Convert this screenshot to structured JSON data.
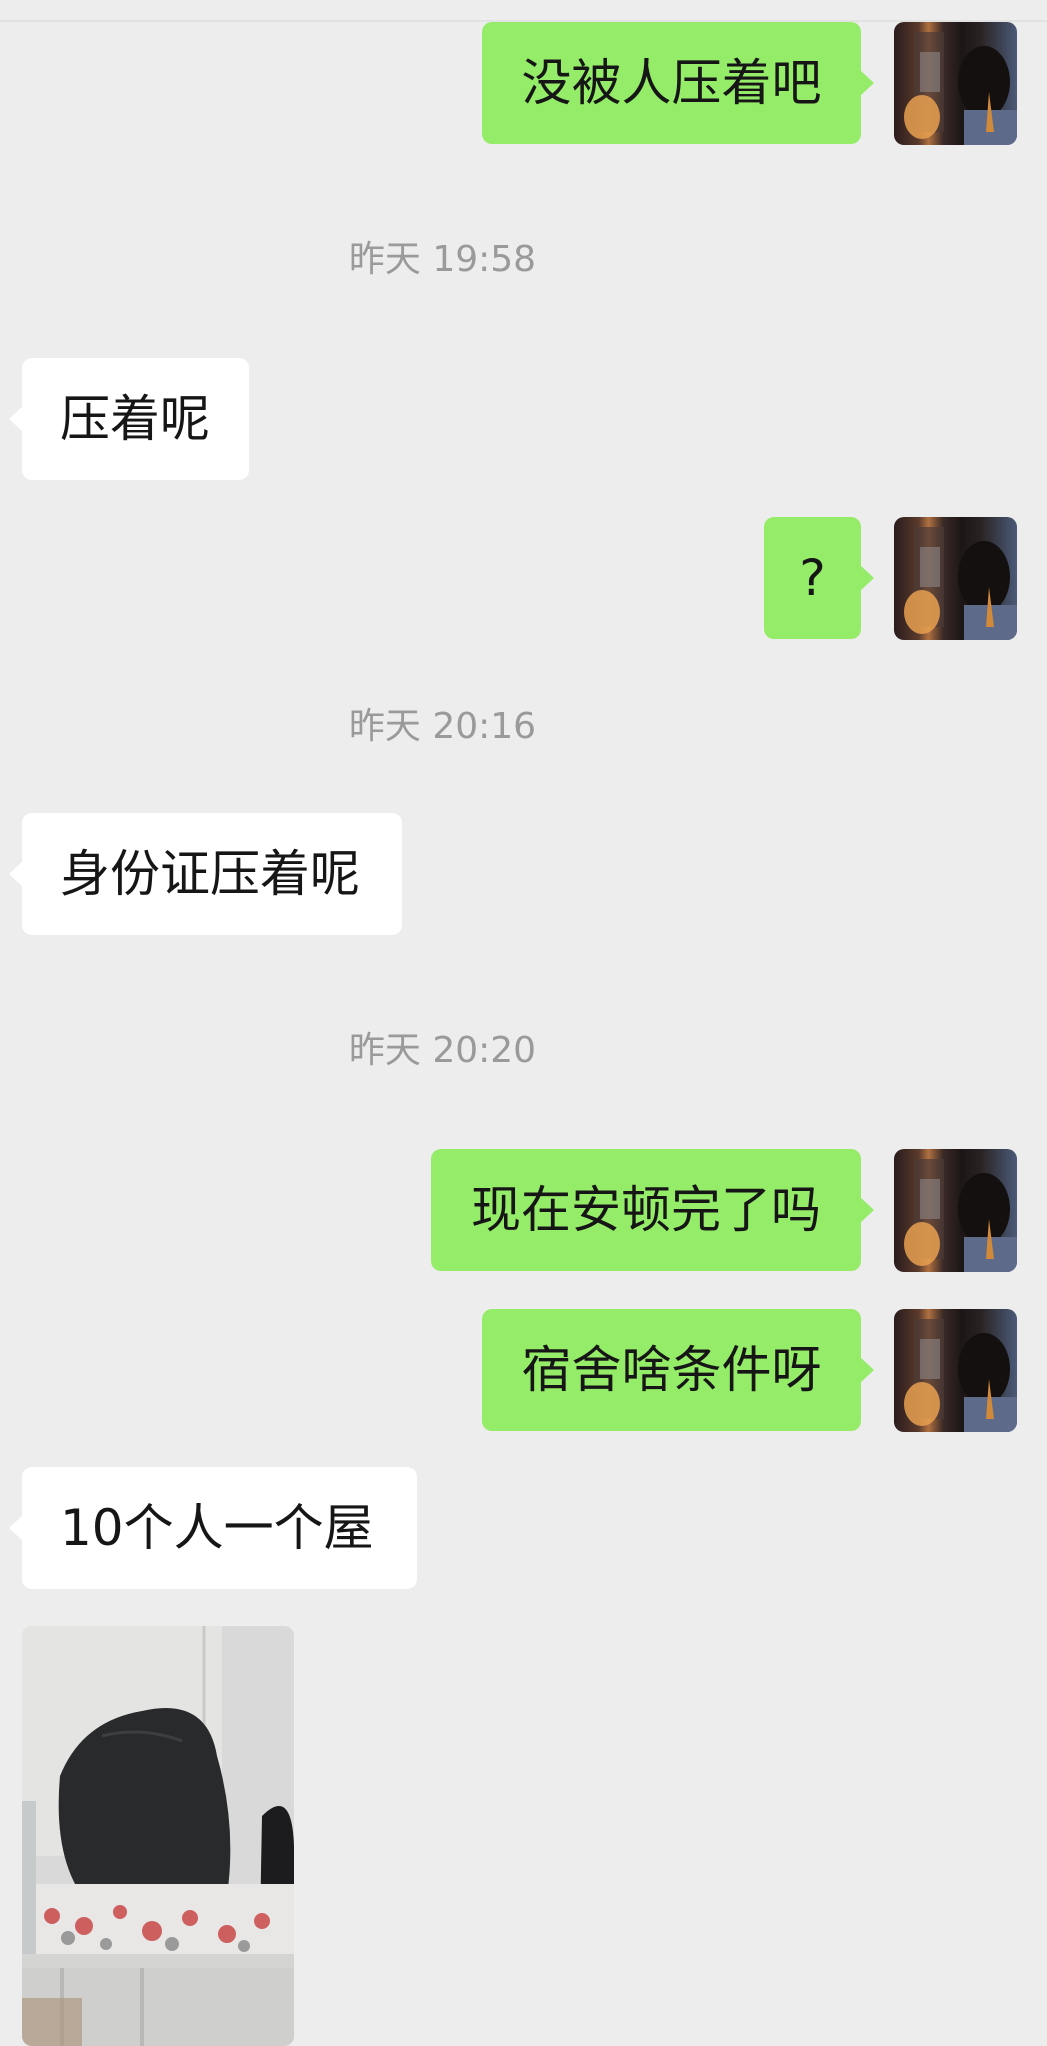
{
  "messages": [
    {
      "side": "out",
      "text": "没被人压着吧"
    },
    {
      "timestamp": "昨天 19:58"
    },
    {
      "side": "in",
      "text": "压着呢"
    },
    {
      "side": "out",
      "text": "?"
    },
    {
      "timestamp": "昨天 20:16"
    },
    {
      "side": "in",
      "text": "身份证压着呢"
    },
    {
      "timestamp": "昨天 20:20"
    },
    {
      "side": "out",
      "text": "现在安顿完了吗"
    },
    {
      "side": "out",
      "text": "宿舍啥条件呀"
    },
    {
      "side": "in",
      "text": "10个人一个屋"
    },
    {
      "side": "in",
      "image": "dormitory-bed-photo"
    }
  ],
  "colors": {
    "background": "#ededed",
    "outgoing_bubble": "#95ec69",
    "incoming_bubble": "#ffffff",
    "timestamp_text": "#9a9a9a",
    "message_text": "#161616"
  },
  "icons": {
    "self_avatar": "user-avatar-photo",
    "image_message": "dormitory-bed-photo"
  }
}
